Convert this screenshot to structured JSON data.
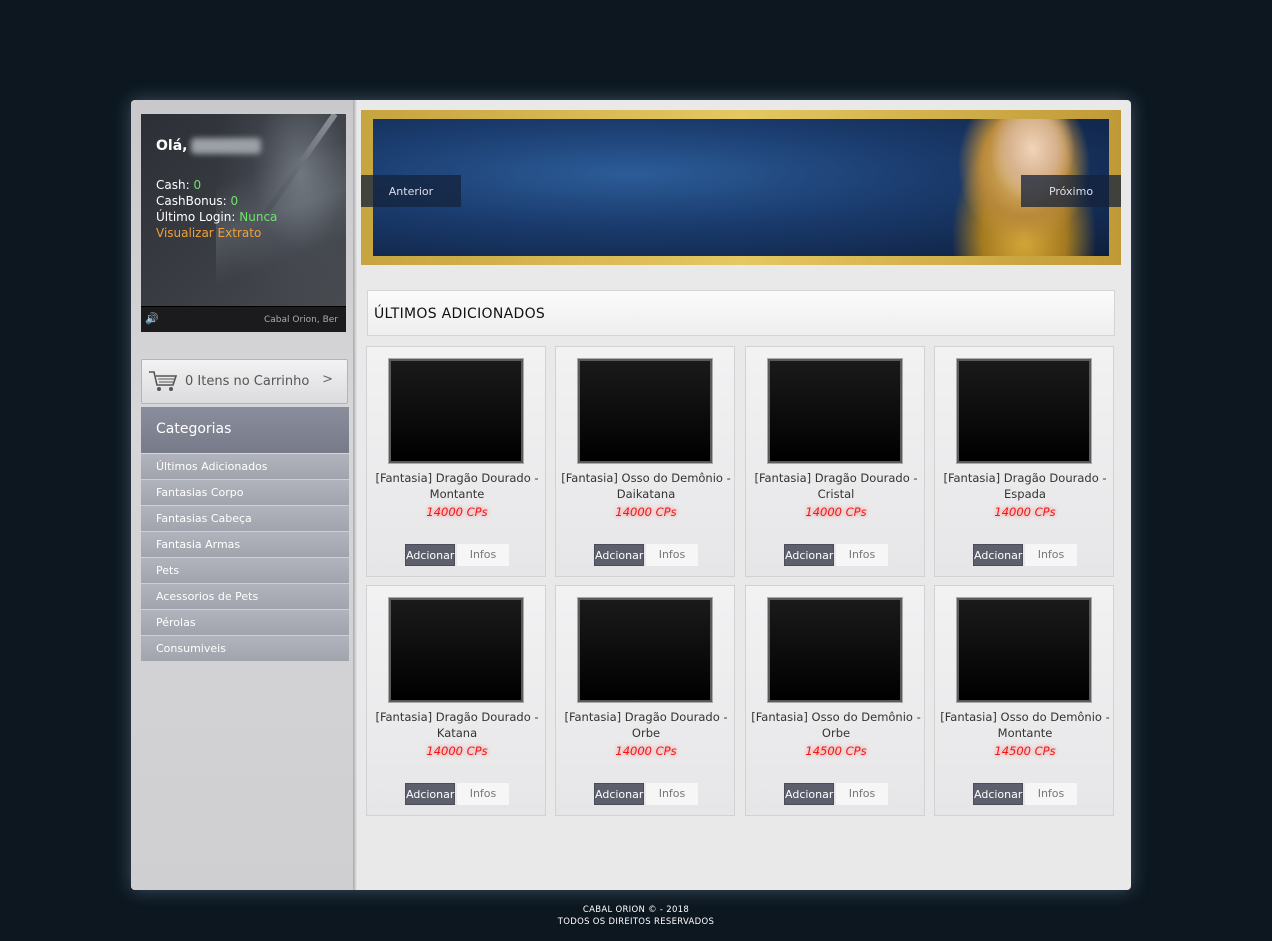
{
  "user": {
    "greeting": "Olá,",
    "cash_label": "Cash:",
    "cash_value": "0",
    "cashbonus_label": "CashBonus:",
    "cashbonus_value": "0",
    "last_login_label": "Último Login:",
    "last_login_value": "Nunca",
    "statement_link": "Visualizar Extrato",
    "now_playing": "Cabal Orion, Ber"
  },
  "cart": {
    "label": "0 Itens no Carrinho",
    "chevron": ">"
  },
  "categories": {
    "title": "Categorias",
    "items": [
      "Últimos Adicionados",
      "Fantasias Corpo",
      "Fantasias Cabeça",
      "Fantasia Armas",
      "Pets",
      "Acessorios de Pets",
      "Pérolas",
      "Consumiveis"
    ]
  },
  "banner": {
    "prev_label": "Anterior",
    "next_label": "Próximo"
  },
  "section": {
    "title": "ÚLTIMOS ADICIONADOS"
  },
  "products": [
    {
      "name": "[Fantasia] Dragão Dourado - Montante",
      "price": "14000 CPs",
      "add": "Adcionar",
      "info": "Infos"
    },
    {
      "name": "[Fantasia] Osso do Demônio - Daikatana",
      "price": "14000 CPs",
      "add": "Adcionar",
      "info": "Infos"
    },
    {
      "name": "[Fantasia] Dragão Dourado - Cristal",
      "price": "14000 CPs",
      "add": "Adcionar",
      "info": "Infos"
    },
    {
      "name": "[Fantasia] Dragão Dourado - Espada",
      "price": "14000 CPs",
      "add": "Adcionar",
      "info": "Infos"
    },
    {
      "name": "[Fantasia] Dragão Dourado - Katana",
      "price": "14000 CPs",
      "add": "Adcionar",
      "info": "Infos"
    },
    {
      "name": "[Fantasia] Dragão Dourado - Orbe",
      "price": "14000 CPs",
      "add": "Adcionar",
      "info": "Infos"
    },
    {
      "name": "[Fantasia] Osso do Demônio - Orbe",
      "price": "14500 CPs",
      "add": "Adcionar",
      "info": "Infos"
    },
    {
      "name": "[Fantasia] Osso do Demônio - Montante",
      "price": "14500 CPs",
      "add": "Adcionar",
      "info": "Infos"
    }
  ],
  "footer": {
    "line1": "CABAL ORION © - 2018",
    "line2": "TODOS OS DIREITOS RESERVADOS"
  },
  "colors": {
    "background": "#0c1720",
    "accent_green": "#6fe36a",
    "accent_orange": "#f0a036",
    "price_red": "#f01818",
    "button": "#5d5f6c"
  }
}
